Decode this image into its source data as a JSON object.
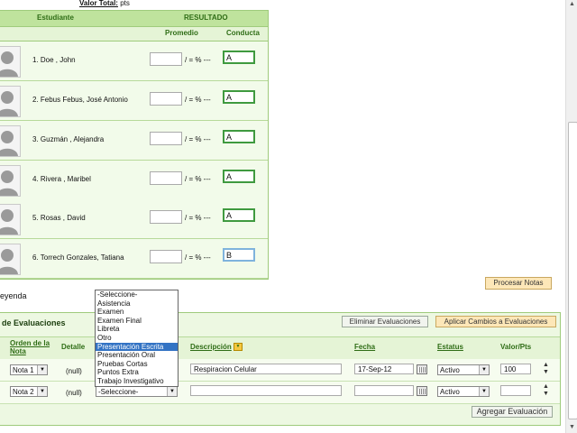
{
  "top": {
    "valor_total_label": "Valor Total:",
    "valor_total_value": "pts"
  },
  "students_panel": {
    "header": {
      "estudiante": "Estudiante",
      "resultado": "RESULTADO",
      "promedio": "Promedio",
      "conducta": "Conducta"
    },
    "pct_text": "/ = % ---",
    "rows": [
      {
        "name": "1. Doe , John",
        "conducta": "A"
      },
      {
        "name": "2. Febus Febus, José Antonio",
        "conducta": "A"
      },
      {
        "name": "3. Guzmán , Alejandra",
        "conducta": "A"
      },
      {
        "name": "4. Rivera , Maribel",
        "conducta": "A"
      },
      {
        "name": "5. Rosas , David",
        "conducta": "A"
      },
      {
        "name": "6. Torrech Gonzales, Tatiana",
        "conducta": "B"
      }
    ]
  },
  "procesar_button": "Procesar Notas",
  "leyenda": "eyenda",
  "evaluations": {
    "title": "de Evaluaciones",
    "eliminar_button": "Eliminar Evaluaciones",
    "aplicar_button": "Aplicar Cambios a Evaluaciones",
    "columns": {
      "orden": "Orden de la Nota",
      "detalle": "Detalle",
      "descripcion": "Descripción",
      "fecha": "Fecha",
      "estatus": "Estatus",
      "valor": "Valor/Pts"
    },
    "rows": [
      {
        "nota": "Nota 1",
        "detalle": "(null)",
        "tipo": "",
        "descripcion": "Respiracion Celular",
        "fecha": "17-Sep-12",
        "estatus": "Activo",
        "valor": "100"
      },
      {
        "nota": "Nota 2",
        "detalle": "(null)",
        "tipo": "-Seleccione-",
        "descripcion": "",
        "fecha": "",
        "estatus": "Activo",
        "valor": ""
      }
    ],
    "agregar_button": "Agregar Evaluación"
  },
  "dropdown": {
    "options": [
      "-Seleccione-",
      "Asistencia",
      "Examen",
      "Examen Final",
      "Libreta",
      "Otro",
      "Presentación Escrita",
      "Presentación Oral",
      "Pruebas Cortas",
      "Puntos Extra",
      "Trabajo Investigativo"
    ],
    "highlighted": "Presentación Escrita"
  },
  "colors": {
    "panel_bg": "#edf8e2",
    "header_green": "#bfe39d",
    "header_text": "#2f6d16",
    "button_orange": "#fde7b8",
    "highlight": "#3373c4"
  }
}
